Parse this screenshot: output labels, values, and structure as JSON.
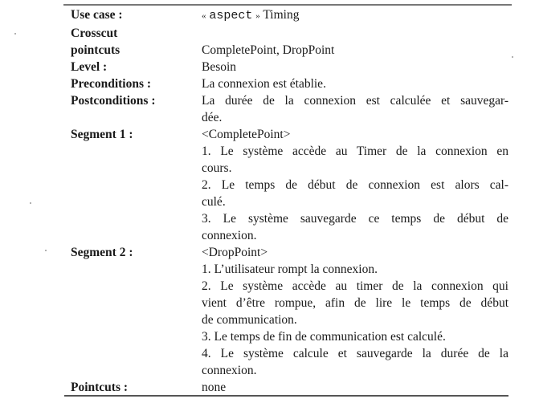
{
  "rows": [
    {
      "label": "Use case :",
      "stereotype_open": "«",
      "stereotype": "aspect",
      "stereotype_close": "»",
      "value": "Timing"
    },
    {
      "label": "Crosscut",
      "value": ""
    },
    {
      "label": "pointcuts",
      "value": "CompletePoint, DropPoint"
    },
    {
      "label": "Level :",
      "value": "Besoin"
    },
    {
      "label": "Preconditions :",
      "value": "La connexion est établie."
    },
    {
      "label": "Postconditions :",
      "lines": [
        "La durée de la connexion est calculée et sauvegar-",
        "dée."
      ]
    },
    {
      "label": "Segment 1 :",
      "lines": [
        "<CompletePoint>",
        "1. Le système accède au Timer de la connexion en",
        "cours.",
        "2. Le temps de début de connexion est alors cal-",
        "culé.",
        "3. Le système sauvegarde ce temps de début de",
        "connexion."
      ]
    },
    {
      "label": "Segment 2 :",
      "lines": [
        "<DropPoint>",
        "1. L’utilisateur rompt la connexion.",
        "2. Le système accède au timer de la connexion qui",
        "vient d’être rompue, afin de lire le temps de début",
        "de communication.",
        "3. Le temps de fin de communication est calculé.",
        "4. Le système calcule et sauvegarde la durée de la",
        "connexion."
      ]
    },
    {
      "label": "Pointcuts :",
      "value": "none"
    }
  ]
}
